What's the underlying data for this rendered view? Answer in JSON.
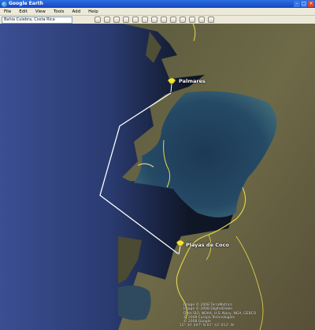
{
  "window": {
    "title": "Google Earth"
  },
  "menu": [
    "File",
    "Edit",
    "View",
    "Tools",
    "Add",
    "Help"
  ],
  "search": {
    "value": "Bahia Culebra, Costa Rica"
  },
  "toolbar": {
    "icons": [
      "hide-sidebar-icon",
      "placemark-icon",
      "polygon-icon",
      "path-icon",
      "image-overlay-icon",
      "record-tour-icon",
      "history-icon",
      "sun-icon",
      "planets-icon",
      "ruler-icon",
      "email-icon",
      "print-icon",
      "view-in-maps-icon"
    ]
  },
  "placemarks": [
    {
      "name": "Palmares"
    },
    {
      "name": "Playas de Coco"
    }
  ],
  "attribution": [
    "Image © 2008 TerraMetrics",
    "Image © 2008 DigitalGlobe",
    "Data SIO, NOAA, U.S. Navy, NGA, GEBCO",
    "© 2008 Europa Technologies",
    "© 2008 Google"
  ],
  "status": {
    "coordinates": "10° 40' 897\" N     85° 43' 653\" W"
  },
  "colors": {
    "titlebar": "#1446c4",
    "path": "#ffffff",
    "road": "#e6d84a",
    "ocean": "#2b3f73"
  }
}
